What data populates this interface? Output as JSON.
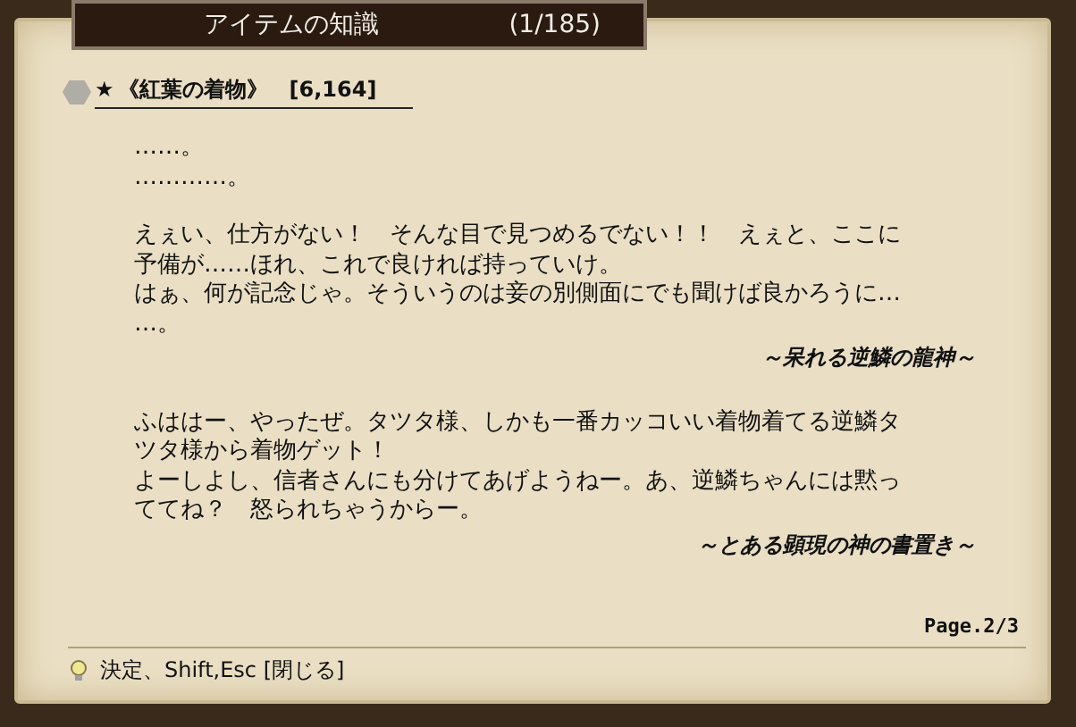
{
  "window": {
    "title": "アイテムの知識",
    "count": "(1/185)"
  },
  "item": {
    "star": "★",
    "name": "《紅葉の着物》",
    "code": "[6,164]"
  },
  "blocks": [
    {
      "kind": "text",
      "lines": [
        "……。",
        "…………。"
      ]
    },
    {
      "kind": "text",
      "lines": [
        "えぇい、仕方がない！　そんな目で見つめるでない！！　えぇと、ここに",
        "予備が……ほれ、これで良ければ持っていけ。",
        "はぁ、何が記念じゃ。そういうのは妾の別側面にでも聞けば良かろうに…",
        "…。"
      ]
    },
    {
      "kind": "signature",
      "lines": [
        "～呆れる逆鱗の龍神～"
      ]
    },
    {
      "kind": "text",
      "lines": [
        "ふははー、やったぜ。タツタ様、しかも一番カッコいい着物着てる逆鱗タ",
        "ツタ様から着物ゲット！",
        "よーしよし、信者さんにも分けてあげようねー。あ、逆鱗ちゃんには黙っ",
        "ててね？　怒られちゃうからー。"
      ]
    },
    {
      "kind": "signature",
      "lines": [
        "～とある顕現の神の書置き～"
      ]
    }
  ],
  "page": "Page.2/3",
  "help": "決定、Shift,Esc [閉じる]"
}
